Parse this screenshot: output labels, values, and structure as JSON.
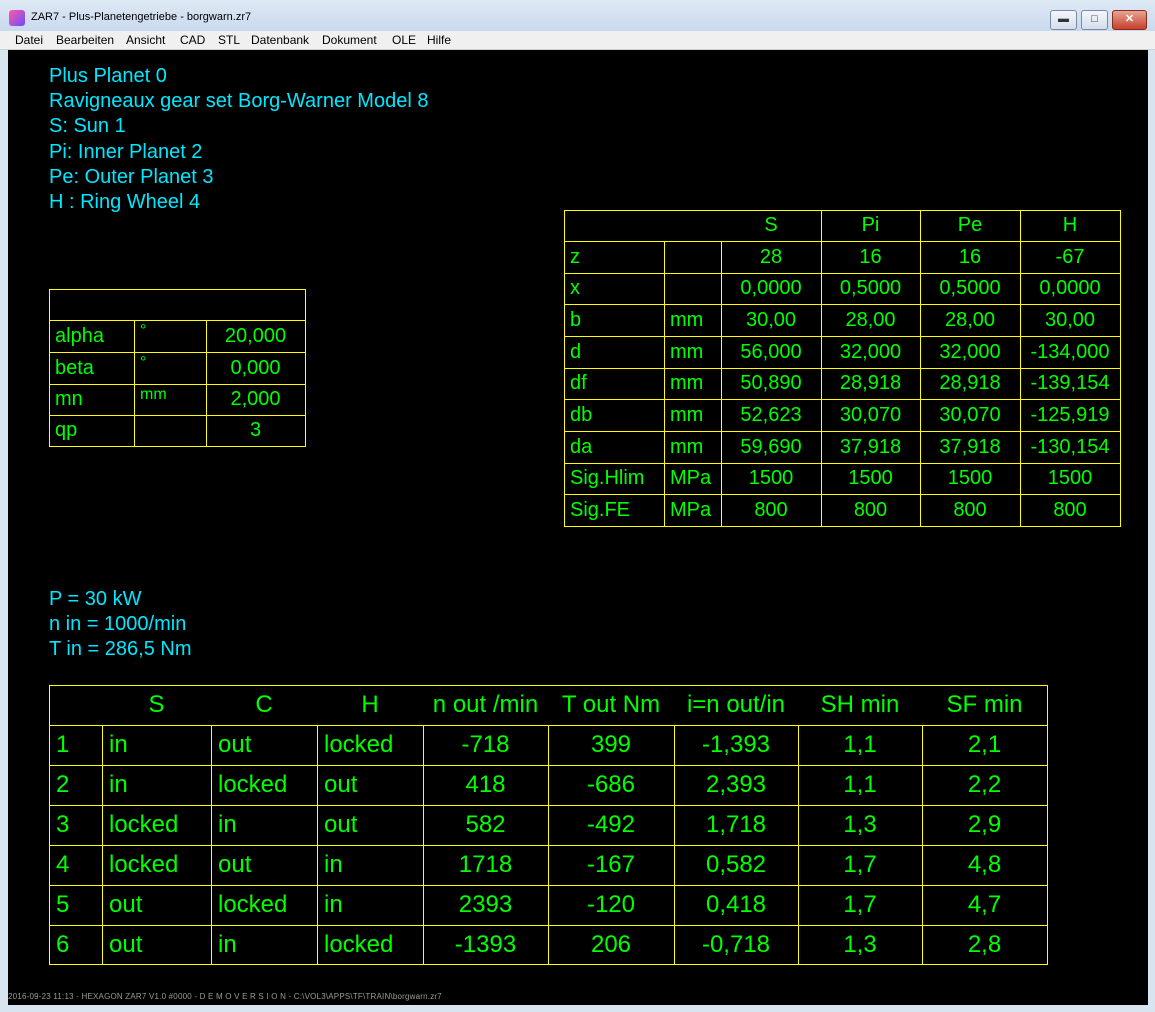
{
  "window": {
    "title": "ZAR7 - Plus-Planetengetriebe  -  borgwarn.zr7",
    "min": "▬",
    "max": "□",
    "close": "✕"
  },
  "menu": [
    "Datei",
    "Bearbeiten",
    "Ansicht",
    "CAD",
    "STL",
    "Datenbank",
    "Dokument",
    "OLE",
    "Hilfe"
  ],
  "info": [
    "Plus Planet 0",
    "Ravigneaux gear set  Borg-Warner Model 8",
    "S: Sun 1",
    "Pi: Inner Planet 2",
    "Pe: Outer Planet 3",
    "H : Ring Wheel 4"
  ],
  "params": {
    "header": "",
    "rows": [
      [
        "alpha",
        "°",
        "20,000"
      ],
      [
        "beta",
        "°",
        "0,000"
      ],
      [
        "mn",
        "mm",
        "2,000"
      ],
      [
        "qp",
        "",
        "3"
      ]
    ]
  },
  "gear": {
    "header": [
      "",
      "",
      "S",
      "Pi",
      "Pe",
      "H"
    ],
    "rows": [
      [
        "z",
        "",
        "28",
        "16",
        "16",
        "-67"
      ],
      [
        "x",
        "",
        "0,0000",
        "0,5000",
        "0,5000",
        "0,0000"
      ],
      [
        "b",
        "mm",
        "30,00",
        "28,00",
        "28,00",
        "30,00"
      ],
      [
        "d",
        "mm",
        "56,000",
        "32,000",
        "32,000",
        "-134,000"
      ],
      [
        "df",
        "mm",
        "50,890",
        "28,918",
        "28,918",
        "-139,154"
      ],
      [
        "db",
        "mm",
        "52,623",
        "30,070",
        "30,070",
        "-125,919"
      ],
      [
        "da",
        "mm",
        "59,690",
        "37,918",
        "37,918",
        "-130,154"
      ],
      [
        "Sig.Hlim",
        "MPa",
        "1500",
        "1500",
        "1500",
        "1500"
      ],
      [
        "Sig.FE",
        "MPa",
        "800",
        "800",
        "800",
        "800"
      ]
    ]
  },
  "load": [
    "P = 30 kW",
    "n in = 1000/min",
    "T in = 286,5 Nm"
  ],
  "modes": {
    "header": [
      "",
      "S",
      "C",
      "H",
      "n out /min",
      "T out Nm",
      "i=n out/in",
      "SH min",
      "SF min"
    ],
    "rows": [
      [
        "1",
        "in",
        "out",
        "locked",
        "-718",
        "399",
        "-1,393",
        "1,1",
        "2,1"
      ],
      [
        "2",
        "in",
        "locked",
        "out",
        "418",
        "-686",
        "2,393",
        "1,1",
        "2,2"
      ],
      [
        "3",
        "locked",
        "in",
        "out",
        "582",
        "-492",
        "1,718",
        "1,3",
        "2,9"
      ],
      [
        "4",
        "locked",
        "out",
        "in",
        "1718",
        "-167",
        "0,582",
        "1,7",
        "4,8"
      ],
      [
        "5",
        "out",
        "locked",
        "in",
        "2393",
        "-120",
        "0,418",
        "1,7",
        "4,7"
      ],
      [
        "6",
        "out",
        "in",
        "locked",
        "-1393",
        "206",
        "-0,718",
        "1,3",
        "2,8"
      ]
    ]
  },
  "status": "2016-09-23 11:13 - HEXAGON ZAR7 V1.0 #0000 - D E M O V E R S I O N - C:\\VOL3\\APPS\\TF\\TRAIN\\borgwarn.zr7"
}
